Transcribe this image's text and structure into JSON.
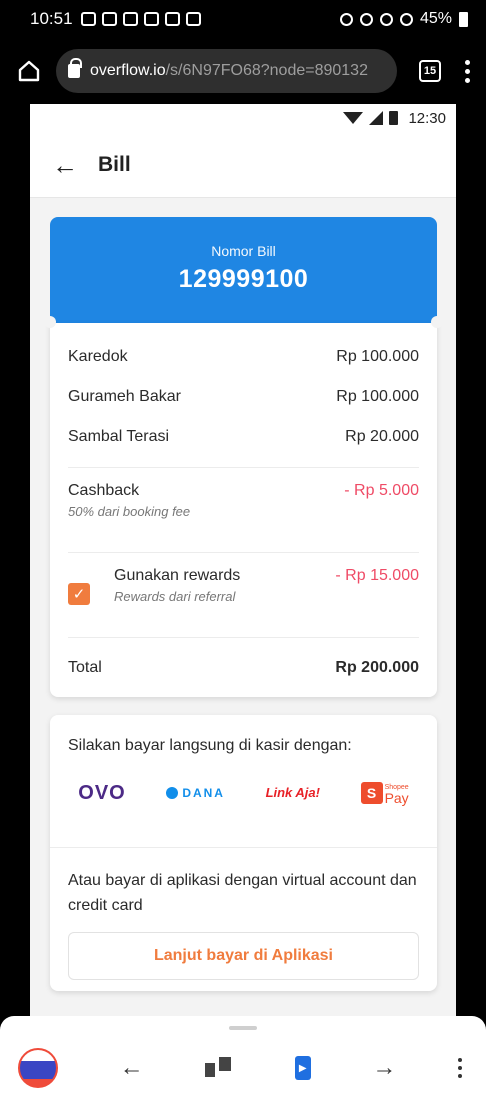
{
  "phone_status": {
    "time": "10:51",
    "battery": "45%"
  },
  "browser": {
    "url_host": "overflow.io",
    "url_path": "/s/6N97FO68?node=890132",
    "tab_count": "15"
  },
  "app_status": {
    "time": "12:30"
  },
  "header": {
    "title": "Bill",
    "back_icon": "←"
  },
  "bill": {
    "label": "Nomor Bill",
    "number": "129999100",
    "items": [
      {
        "name": "Karedok",
        "price": "Rp 100.000"
      },
      {
        "name": "Gurameh Bakar",
        "price": "Rp 100.000"
      },
      {
        "name": "Sambal Terasi",
        "price": "Rp 20.000"
      }
    ],
    "cashback": {
      "label": "Cashback",
      "note": "50% dari booking fee",
      "value": "- Rp 5.000"
    },
    "rewards": {
      "label": "Gunakan rewards",
      "note": "Rewards dari referral",
      "value": "- Rp 15.000",
      "checked": true
    },
    "total": {
      "label": "Total",
      "value": "Rp 200.000"
    }
  },
  "payment": {
    "title": "Silakan bayar langsung di kasir dengan:",
    "logos": {
      "ovo": "OVO",
      "dana": "DANA",
      "linkaja": "Link Aja!",
      "shopee_small": "Shopee",
      "shopee_pay": "Pay",
      "shopee_bag": "S"
    },
    "alt_text": "Atau bayar di aplikasi dengan virtual account dan credit card",
    "button": "Lanjut bayar di Aplikasi"
  },
  "colors": {
    "accent_blue": "#1f86e3",
    "accent_orange": "#f07c3e",
    "negative": "#ef4b66"
  }
}
